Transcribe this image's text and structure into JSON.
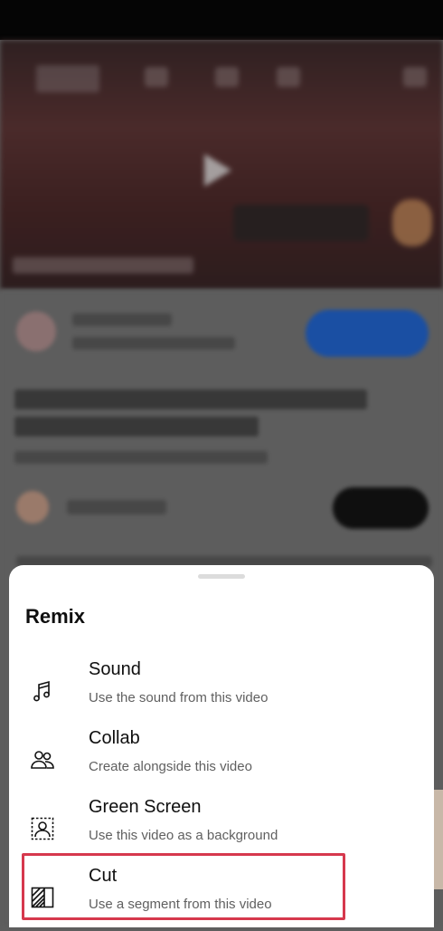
{
  "remix_sheet": {
    "title": "Remix",
    "options": [
      {
        "label": "Sound",
        "description": "Use the sound from this video",
        "icon": "music-note-icon"
      },
      {
        "label": "Collab",
        "description": "Create alongside this video",
        "icon": "people-icon"
      },
      {
        "label": "Green Screen",
        "description": "Use this video as a background",
        "icon": "green-screen-icon"
      },
      {
        "label": "Cut",
        "description": "Use a segment from this video",
        "icon": "cut-segment-icon"
      }
    ],
    "highlighted_option": "Cut",
    "highlight_color": "#d6384d"
  },
  "colors": {
    "shop_button": "#1a4fa3",
    "subscribe_button": "#0f0f0f",
    "sheet_background": "#ffffff"
  }
}
